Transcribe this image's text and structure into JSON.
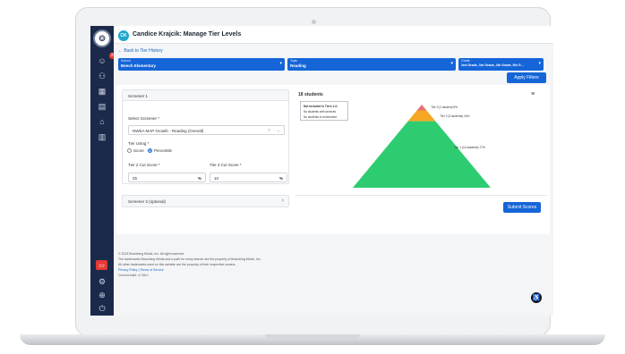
{
  "header": {
    "avatar_initials": "CK",
    "title": "Candice Krajcik: Manage Tier Levels"
  },
  "back_link": "← Back to Tier History",
  "sidebar": {
    "badge_count": "24"
  },
  "filters": [
    {
      "label": "School",
      "value": "Beech Elementary"
    },
    {
      "label": "Topic",
      "value": "Reading"
    },
    {
      "label": "Grade",
      "value": "2nd Grade, 3rd Grade, 4th Grade, 5th G..."
    }
  ],
  "apply_label": "Apply Filters",
  "screener1": {
    "title": "Screener 1",
    "select_label": "Select Screener *",
    "select_value": "NWEA MAP Growth - Reading (Overall)",
    "tier_using_label": "Tier Using *",
    "option_score": "Score",
    "option_percentile": "Percentile",
    "selected_option": "Percentile",
    "tier2_label": "Tier 2 Cut Score *",
    "tier2_value": "25",
    "tier3_label": "Tier 3 Cut Score *",
    "tier3_value": "10",
    "percent_symbol": "%"
  },
  "screener2": {
    "title": "Screener 2 (optional)"
  },
  "chart": {
    "students_label": "18 students",
    "legend_title": "Not included in Tiers 1-3:",
    "legend_line1": "No students with services",
    "legend_line2": "No students in enrichment"
  },
  "chart_data": {
    "type": "pyramid",
    "series": [
      {
        "name": "Tier 3 (1 student) 5%",
        "value": 1,
        "percent": 5,
        "color": "#e57373"
      },
      {
        "name": "Tier 2 (3 students) 16%",
        "value": 3,
        "percent": 16,
        "color": "#f5a623"
      },
      {
        "name": "Tier 1 (14 students) 77%",
        "value": 14,
        "percent": 77,
        "color": "#2ecc71"
      }
    ]
  },
  "submit_label": "Submit Scores",
  "footer": {
    "line1": "© 2023 Branching Minds, Inc. All right reserved.",
    "line2": "The trademarks Branching Minds and a path for every learner are the property of Branching Minds, Inc.",
    "line3": "All other trademarks used on this website are the property of their respective owners.",
    "privacy": "Privacy Policy",
    "separator": "|",
    "terms": "Terms of Service",
    "build": "Current build: v7.56.0"
  },
  "colors": {
    "primary": "#1565d8",
    "sidebar": "#1b2a4a",
    "accent_avatar": "#1ea7c9"
  }
}
